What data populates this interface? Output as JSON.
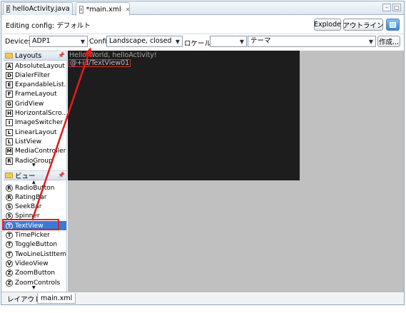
{
  "tabs": [
    {
      "label": "helloActivity.java",
      "icon": "java-file-icon",
      "active": false
    },
    {
      "label": "*main.xml",
      "icon": "xml-file-icon",
      "active": true
    }
  ],
  "editing_config": {
    "label": "Editing config: デフォルト",
    "explode_label": "Explode",
    "outline_label": "アウトライン"
  },
  "devices_row": {
    "devices_label": "Devices",
    "devices_value": "ADP1",
    "config_label": "Config",
    "config_value": "Landscape, closed",
    "locale_label": "ロケール",
    "locale_value": "",
    "theme_value": "テーマ",
    "create_label": "作成..."
  },
  "palette": {
    "layouts_header": "Layouts",
    "layouts": [
      "AbsoluteLayout",
      "DialerFilter",
      "ExpandableList...",
      "FrameLayout",
      "GridView",
      "HorizontalScro...",
      "ImageSwitcher",
      "LinearLayout",
      "ListView",
      "MediaController",
      "RadioGroup"
    ],
    "layout_icons": [
      "A",
      "D",
      "E",
      "F",
      "G",
      "H",
      "I",
      "L",
      "L",
      "M",
      "R"
    ],
    "views_header": "ビュー",
    "views": [
      "RadioButton",
      "RatingBar",
      "SeekBar",
      "Spinner",
      "TextView",
      "TimePicker",
      "ToggleButton",
      "TwoLineListItem",
      "VideoView",
      "ZoomButton",
      "ZoomControls"
    ],
    "view_icons": [
      "R",
      "R",
      "S",
      "S",
      "T",
      "T",
      "T",
      "T",
      "V",
      "Z",
      "Z"
    ],
    "selected_view": "TextView"
  },
  "canvas": {
    "hello_text": "Hello World, helloActivity!",
    "textview_id": "@+id/TextView01"
  },
  "bottom_tabs": {
    "layout_label": "レイアウト",
    "main_label": "main.xml"
  },
  "colors": {
    "selection": "#3a7ad3",
    "annotation_red": "#e01b1b",
    "canvas_bg": "#1d1d1d",
    "editor_bg": "#c0c0c0"
  }
}
